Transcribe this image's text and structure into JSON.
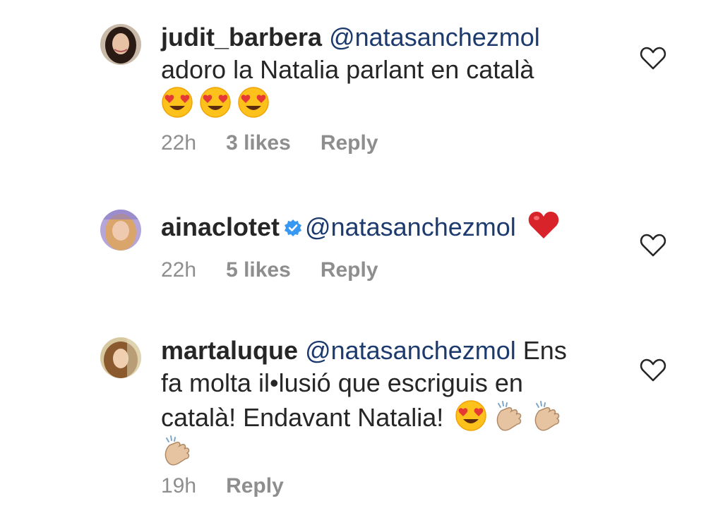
{
  "comments": [
    {
      "username": "judit_barbera",
      "mention": "@natasanchezmol",
      "text": "adoro la Natalia parlant en català",
      "trailing_emojis": [
        "heart-eyes",
        "heart-eyes",
        "heart-eyes"
      ],
      "time": "22h",
      "likes": "3 likes",
      "reply": "Reply"
    },
    {
      "username": "ainaclotet",
      "verified": true,
      "mention": "@natasanchezmol",
      "trailing_emojis": [
        "red-heart"
      ],
      "time": "22h",
      "likes": "5 likes",
      "reply": "Reply"
    },
    {
      "username": "martaluque",
      "mention": "@natasanchezmol",
      "text_line1": "Ens",
      "text_line2": "fa molta il•lusió que escriguis en",
      "text_line3": "català! Endavant Natalia!",
      "trailing_emojis": [
        "heart-eyes",
        "clapping-hands",
        "clapping-hands",
        "clapping-hands"
      ],
      "time": "19h",
      "reply": "Reply"
    }
  ],
  "colors": {
    "username": "#262626",
    "mention": "#1c3a6e",
    "meta": "#8e8e8e",
    "verified": "#3897f0"
  }
}
